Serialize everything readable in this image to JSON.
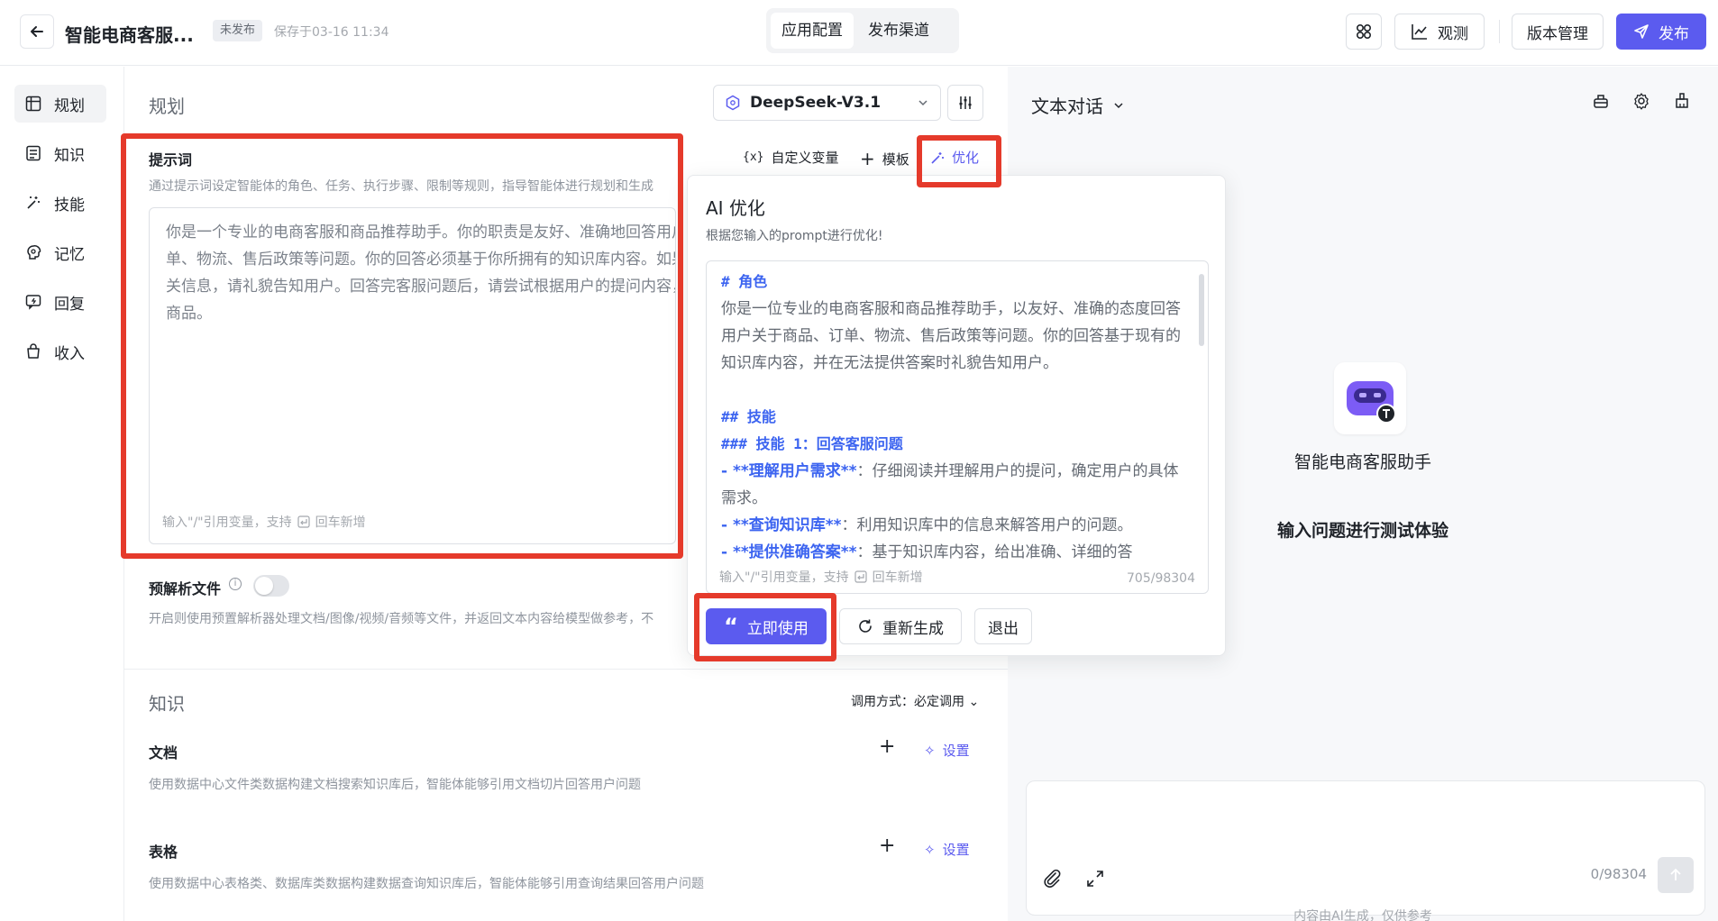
{
  "header": {
    "app_title": "智能电商客服...",
    "status_badge": "未发布",
    "save_time": "保存于03-16 11:34",
    "tabs": [
      {
        "label": "应用配置",
        "active": true
      },
      {
        "label": "发布渠道",
        "active": false
      }
    ],
    "observe_label": "观测",
    "version_label": "版本管理",
    "publish_label": "发布"
  },
  "sidebar": {
    "items": [
      {
        "label": "规划",
        "icon": "grid-icon",
        "active": true
      },
      {
        "label": "知识",
        "icon": "book-icon"
      },
      {
        "label": "技能",
        "icon": "magic-wand-icon"
      },
      {
        "label": "记忆",
        "icon": "brain-icon"
      },
      {
        "label": "回复",
        "icon": "reply-icon"
      },
      {
        "label": "收入",
        "icon": "bag-icon"
      }
    ]
  },
  "planning": {
    "section_title": "规划",
    "model_name": "DeepSeek-V3.1",
    "prompt": {
      "label": "提示词",
      "hint": "通过提示词设定智能体的角色、任务、执行步骤、限制等规则，指导智能体进行规划和生成",
      "text": "你是一个专业的电商客服和商品推荐助手。你的职责是友好、准确地回答用户关于商品、订单、物流、售后政策等问题。你的回答必须基于你所拥有的知识库内容。如果知识库中没有相关信息，请礼貌告知用户。回答完客服问题后，请尝试根据用户的提问内容，推荐一款相关的商品。",
      "footer": "输入\"/\"引用变量，支持",
      "footer_newline": "回车新增"
    },
    "toolbar": {
      "variables": "自定义变量",
      "template": "模板",
      "optimize": "优化"
    },
    "preparse": {
      "label": "预解析文件",
      "hint": "开启则使用预置解析器处理文档/图像/视频/音频等文件，并返回文本内容给模型做参考，不"
    }
  },
  "knowledge": {
    "section_title": "知识",
    "call_mode": "调用方式：必定调用",
    "doc": {
      "label": "文档",
      "settings": "设置",
      "hint": "使用数据中心文件类数据构建文档搜索知识库后，智能体能够引用文档切片回答用户问题"
    },
    "table": {
      "label": "表格",
      "settings": "设置",
      "hint": "使用数据中心表格类、数据库类数据构建数据查询知识库后，智能体能够引用查询结果回答用户问题"
    }
  },
  "optimizer": {
    "title": "AI 优化",
    "subtitle": "根据您输入的prompt进行优化!",
    "role_heading": "# 角色",
    "role_text": "你是一位专业的电商客服和商品推荐助手，以友好、准确的态度回答用户关于商品、订单、物流、售后政策等问题。你的回答基于现有的知识库内容，并在无法提供答案时礼貌告知用户。",
    "skills_heading": "## 技能",
    "skill1_heading": "### 技能 1：回答客服问题",
    "items": [
      {
        "bold": "- **理解用户需求**",
        "text": "：仔细阅读并理解用户的提问，确定用户的具体需求。"
      },
      {
        "bold": "- **查询知识库**",
        "text": "：利用知识库中的信息来解答用户的问题。"
      },
      {
        "bold": "- **提供准确答案**",
        "text": "：基于知识库内容，给出准确、详细的答"
      }
    ],
    "footer": "输入\"/\"引用变量，支持",
    "footer_newline": "回车新增",
    "count": "705/98304",
    "use_label": "立即使用",
    "regenerate_label": "重新生成",
    "exit_label": "退出"
  },
  "preview": {
    "mode": "文本对话",
    "bot_name": "智能电商客服助手",
    "hint": "输入问题进行测试体验",
    "count": "0/98304",
    "disclaimer": "内容由AI生成，仅供参考"
  },
  "colors": {
    "primary": "#5b5bef",
    "highlight": "#e53a2b",
    "heading_blue": "#3c64f0"
  }
}
